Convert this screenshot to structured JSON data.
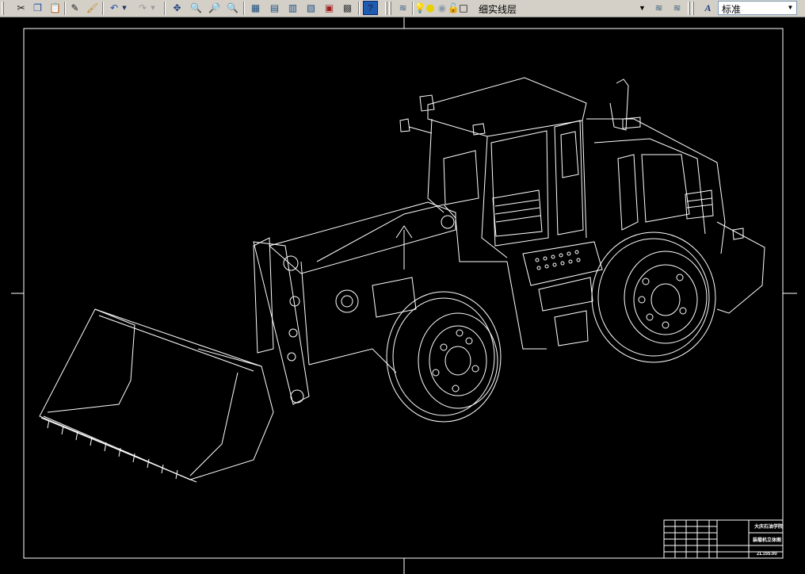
{
  "toolbar": {
    "buttons": [
      {
        "name": "cut-icon",
        "glyph": "✂",
        "color": "#202020"
      },
      {
        "name": "copy-icon",
        "glyph": "❐",
        "color": "#1f4fa0"
      },
      {
        "name": "paste-icon",
        "glyph": "📋",
        "color": "#b08020"
      },
      {
        "name": "match-properties-icon",
        "glyph": "✎",
        "color": "#202020"
      },
      {
        "name": "brush-icon",
        "glyph": "🖌",
        "color": "#c08020"
      },
      {
        "name": "undo-icon",
        "glyph": "↶",
        "color": "#1f4fa0"
      },
      {
        "name": "redo-icon",
        "glyph": "↷",
        "color": "#9a9a9a"
      },
      {
        "name": "pan-icon",
        "glyph": "✥",
        "color": "#204080"
      },
      {
        "name": "zoom-realtime-icon",
        "glyph": "🔍",
        "color": "#204080"
      },
      {
        "name": "zoom-window-icon",
        "glyph": "🔎",
        "color": "#204080"
      },
      {
        "name": "zoom-previous-icon",
        "glyph": "🔍",
        "color": "#204080"
      },
      {
        "name": "properties-icon",
        "glyph": "▦",
        "color": "#205080"
      },
      {
        "name": "design-center-icon",
        "glyph": "▤",
        "color": "#205080"
      },
      {
        "name": "tool-palettes-icon",
        "glyph": "▥",
        "color": "#205080"
      },
      {
        "name": "sheet-set-icon",
        "glyph": "▧",
        "color": "#205080"
      },
      {
        "name": "markup-icon",
        "glyph": "▣",
        "color": "#a02020"
      },
      {
        "name": "calculator-icon",
        "glyph": "▩",
        "color": "#404040"
      },
      {
        "name": "help-icon",
        "glyph": "?",
        "color": "#ffffff"
      }
    ],
    "layer_combo": {
      "value": "细实线层"
    },
    "layer_state_icons": [
      "lightbulb-icon",
      "sun-icon",
      "lock-icon",
      "color-square-icon"
    ],
    "style_combo": {
      "value": "标准"
    }
  },
  "title_block": {
    "school": "大庆石油学院",
    "drawing_title": "装载机立体图",
    "drawing_number": "ZL155.00"
  },
  "colors": {
    "toolbar_bg": "#d4d0c8",
    "canvas_bg": "#000000",
    "line": "#ffffff"
  }
}
